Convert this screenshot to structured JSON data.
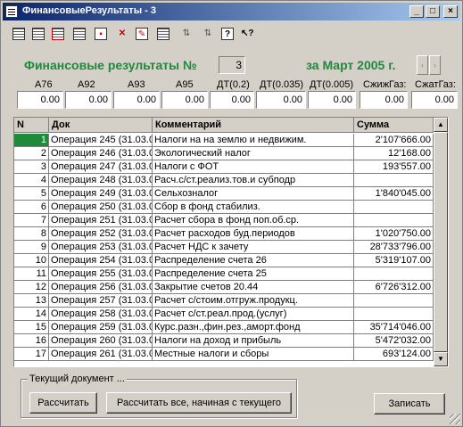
{
  "window": {
    "title": "ФинансовыеРезультаты - 3"
  },
  "titlebar_buttons": [
    "_",
    "□",
    "×"
  ],
  "toolbar": {
    "icons": [
      "new-doc-icon",
      "new-doc-copy-icon",
      "delete-doc-icon",
      "print-icon",
      "journal-icon",
      "post-icon",
      "edit-icon",
      "add-row-icon",
      "sort-asc-icon",
      "sort-desc-icon",
      "help-icon",
      "pointer-help-icon"
    ]
  },
  "header": {
    "title": "Финансовые результаты №",
    "number": "3",
    "period": "за Март 2005 г.",
    "prev_arrow": "‹",
    "next_arrow": "›"
  },
  "fields": [
    {
      "label": "А76",
      "value": "0.00"
    },
    {
      "label": "А92",
      "value": "0.00"
    },
    {
      "label": "А93",
      "value": "0.00"
    },
    {
      "label": "А95",
      "value": "0.00"
    },
    {
      "label": "ДТ(0.2)",
      "value": "0.00"
    },
    {
      "label": "ДТ(0.035)",
      "value": "0.00"
    },
    {
      "label": "ДТ(0.005)",
      "value": "0.00"
    },
    {
      "label": "СжижГаз:",
      "value": "0.00"
    },
    {
      "label": "СжатГаз:",
      "value": "0.00"
    }
  ],
  "table": {
    "columns": [
      "N",
      "Док",
      "Комментарий",
      "Сумма"
    ],
    "rows": [
      {
        "n": "1",
        "doc": "Операция 245 (31.03.0",
        "comment": "Налоги на на землю и недвижим.",
        "sum": "2'107'666.00"
      },
      {
        "n": "2",
        "doc": "Операция 246 (31.03.0",
        "comment": "Экологический налог",
        "sum": "12'168.00"
      },
      {
        "n": "3",
        "doc": "Операция 247 (31.03.0",
        "comment": "Налоги с ФОТ",
        "sum": "193'557.00"
      },
      {
        "n": "4",
        "doc": "Операция 248 (31.03.0",
        "comment": "Расч.с/ст.реализ.тов.и субподр",
        "sum": ""
      },
      {
        "n": "5",
        "doc": "Операция 249 (31.03.0",
        "comment": "Сельхозналог",
        "sum": "1'840'045.00"
      },
      {
        "n": "6",
        "doc": "Операция 250 (31.03.0",
        "comment": "Сбор в фонд стабилиз.",
        "sum": ""
      },
      {
        "n": "7",
        "doc": "Операция 251 (31.03.0",
        "comment": "Расчет сбора в фонд поп.об.ср.",
        "sum": ""
      },
      {
        "n": "8",
        "doc": "Операция 252 (31.03.0",
        "comment": "Расчет расходов буд.периодов",
        "sum": "1'020'750.00"
      },
      {
        "n": "9",
        "doc": "Операция 253 (31.03.0",
        "comment": "Расчет НДС к зачету",
        "sum": "28'733'796.00"
      },
      {
        "n": "10",
        "doc": "Операция 254 (31.03.0",
        "comment": "Распределение счета 26",
        "sum": "5'319'107.00"
      },
      {
        "n": "11",
        "doc": "Операция 255 (31.03.0",
        "comment": "Распределение счета 25",
        "sum": ""
      },
      {
        "n": "12",
        "doc": "Операция 256 (31.03.0",
        "comment": "Закрытие счетов 20.44",
        "sum": "6'726'312.00"
      },
      {
        "n": "13",
        "doc": "Операция 257 (31.03.0",
        "comment": "Расчет с/стоим.отгруж.продукц.",
        "sum": ""
      },
      {
        "n": "14",
        "doc": "Операция 258 (31.03.0",
        "comment": "Расчет с/ст.реал.прод.(услуг)",
        "sum": ""
      },
      {
        "n": "15",
        "doc": "Операция 259 (31.03.0",
        "comment": "Курс.разн.,фин.рез.,аморт.фонд",
        "sum": "35'714'046.00"
      },
      {
        "n": "16",
        "doc": "Операция 260 (31.03.0",
        "comment": "Налоги на доход и прибыль",
        "sum": "5'472'032.00"
      },
      {
        "n": "17",
        "doc": "Операция 261 (31.03.0",
        "comment": "Местные налоги и сборы",
        "sum": "693'124.00"
      }
    ]
  },
  "footer": {
    "group_label": "Текущий документ ...",
    "calc_button": "Рассчитать",
    "calc_all_button": "Рассчитать все, начиная с текущего",
    "save_button": "Записать"
  },
  "colors": {
    "accent": "#1e8a3c",
    "title_start": "#0a246a",
    "title_end": "#a6caf0",
    "face": "#d4d0c8"
  }
}
